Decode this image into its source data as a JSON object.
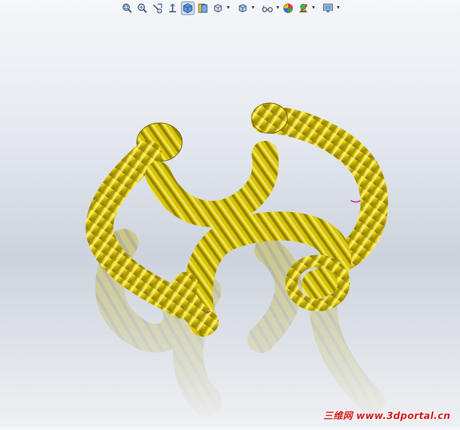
{
  "toolbar": {
    "icons": [
      "zoom-to-fit-icon",
      "zoom-to-area-icon",
      "previous-view-icon",
      "section-view-icon",
      "view-orientation-icon",
      "display-style-icon",
      "hide-show-items-icon",
      "edit-appearance-icon",
      "apply-scene-icon",
      "view-settings-icon"
    ]
  },
  "model": {
    "name": "twisted-rope-bracelet",
    "color": "#e6d000"
  },
  "colors": {
    "gold_light": "#fff36a",
    "gold_mid": "#e9d300",
    "gold_dark": "#6b5a00",
    "accent_blue": "#3a6fb0"
  },
  "watermark": {
    "text": "三维网 www.3dportal.cn"
  }
}
